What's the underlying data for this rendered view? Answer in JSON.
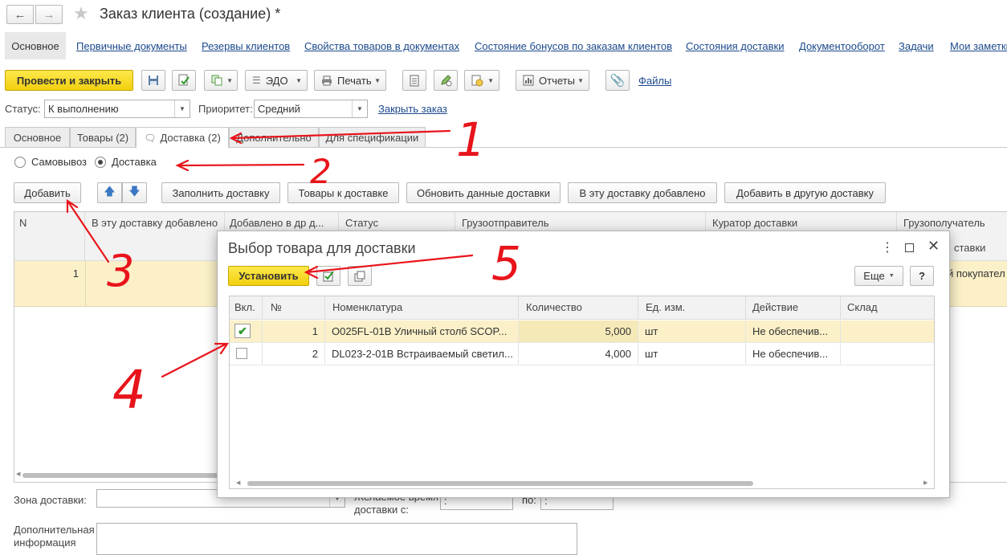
{
  "window": {
    "title": "Заказ клиента (создание) *"
  },
  "nav": {
    "items": [
      "Основное",
      "Первичные документы",
      "Резервы клиентов",
      "Свойства товаров в документах",
      "Состояние бонусов по заказам клиентов",
      "Состояния доставки",
      "Документооборот",
      "Задачи",
      "Мои заметки"
    ]
  },
  "toolbar": {
    "post_close": "Провести и закрыть",
    "edo": "ЭДО",
    "print": "Печать",
    "reports": "Отчеты",
    "files": "Файлы"
  },
  "status_row": {
    "status_label": "Статус:",
    "status_value": "К выполнению",
    "priority_label": "Приоритет:",
    "priority_value": "Средний",
    "close_order": "Закрыть заказ"
  },
  "tabs": [
    "Основное",
    "Товары (2)",
    "Доставка (2)",
    "Дополнительно",
    "Для спецификации"
  ],
  "delivery": {
    "pickup": "Самовывоз",
    "delivery": "Доставка",
    "selected": "Доставка"
  },
  "delivery_toolbar": {
    "add": "Добавить",
    "fill": "Заполнить доставку",
    "goods_to_delivery": "Товары к доставке",
    "update_data": "Обновить данные доставки",
    "added_to_this": "В эту доставку добавлено",
    "add_to_other": "Добавить в другую доставку"
  },
  "main_table": {
    "columns": [
      "N",
      "В эту доставку добавлено",
      "Добавлено в др д...",
      "Статус",
      "Грузоотправитель",
      "Куратор доставки",
      "Грузополучатель"
    ],
    "row": {
      "n": "1"
    },
    "peek_header": "ставки",
    "peek_cell": "й покупател"
  },
  "bottom": {
    "zone_label": "Зона доставки:",
    "time_label_1": "Желаемое время",
    "time_label_2": "доставки с:",
    "to_label": "по:",
    "time_from": ":",
    "time_to": ":",
    "extra_label_1": "Дополнительная",
    "extra_label_2": "информация"
  },
  "dialog": {
    "title": "Выбор товара для доставки",
    "set_button": "Установить",
    "more": "Еще",
    "help": "?",
    "columns": [
      "Вкл.",
      "№",
      "Номенклатура",
      "Количество",
      "Ед. изм.",
      "Действие",
      "Склад"
    ],
    "rows": [
      {
        "checked": true,
        "n": "1",
        "item": "O025FL-01B Уличный столб SCOP...",
        "qty": "5,000",
        "unit": "шт",
        "action": "Не обеспечив...",
        "warehouse": ""
      },
      {
        "checked": false,
        "n": "2",
        "item": "DL023-2-01B Встраиваемый светил...",
        "qty": "4,000",
        "unit": "шт",
        "action": "Не обеспечив...",
        "warehouse": ""
      }
    ]
  },
  "annotations": {
    "n1": "1",
    "n2": "2",
    "n3": "3",
    "n4": "4",
    "n5": "5"
  },
  "colors": {
    "accent_yellow": "#f5d327",
    "link": "#1c4a8c",
    "row_highlight": "#fbf0c8",
    "annotation": "#e8141b"
  }
}
